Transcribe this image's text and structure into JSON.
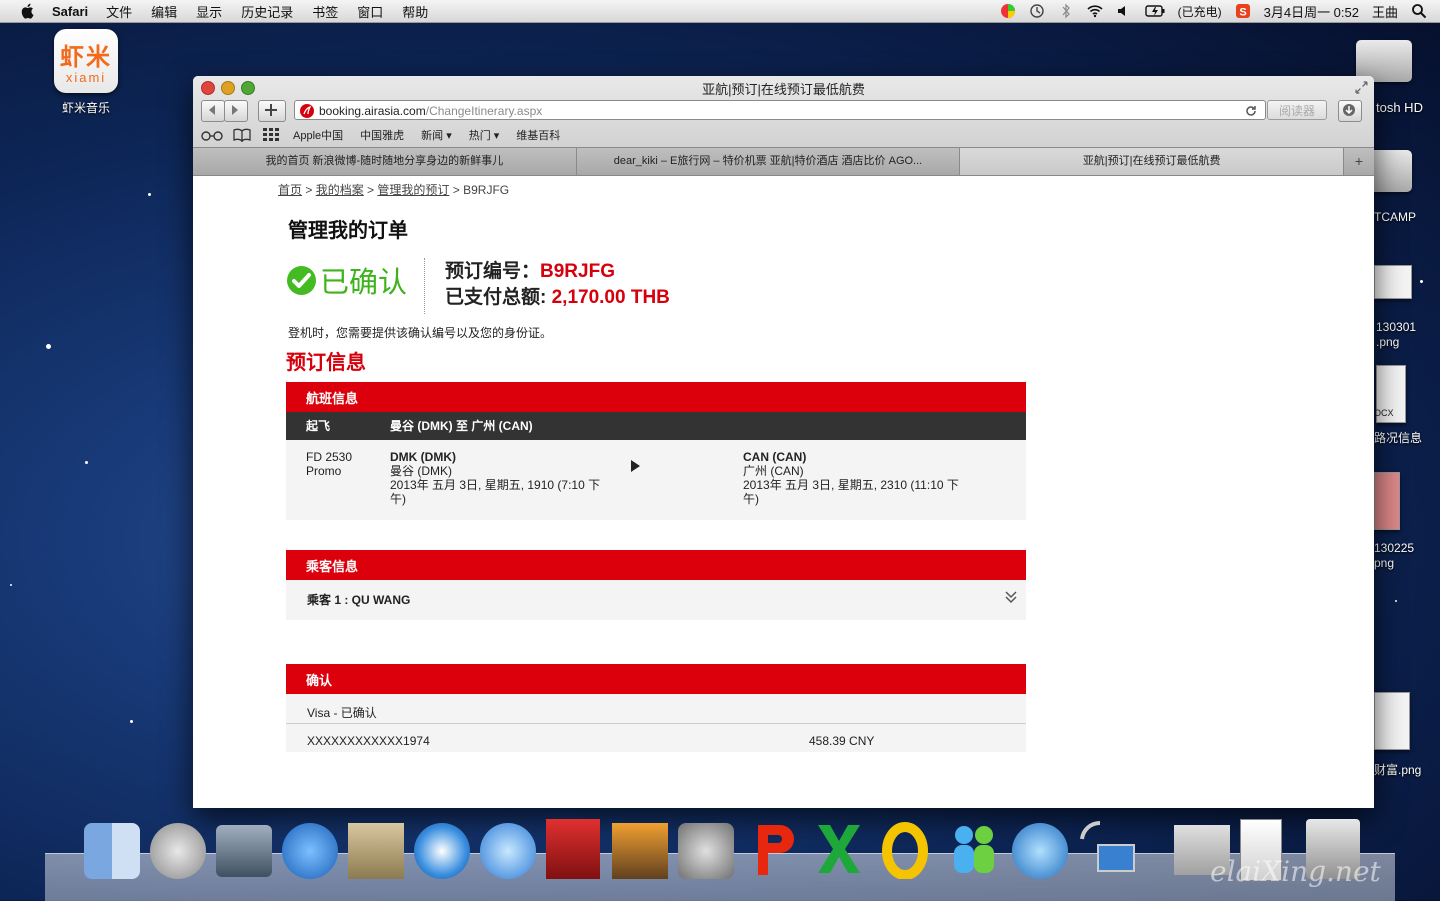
{
  "menubar": {
    "app_name": "Safari",
    "items": [
      "文件",
      "编辑",
      "显示",
      "历史记录",
      "书签",
      "窗口",
      "帮助"
    ],
    "battery": "(已充电)",
    "clock": "3月4日周一  0:52",
    "user": "王曲"
  },
  "desktop": {
    "xiami_cn": "虾米",
    "xiami_en": "xiami",
    "xiami_label": "虾米音乐",
    "labels": [
      "tosh HD",
      "TCAMP",
      "130301",
      ".png",
      "OCX",
      "路况信息",
      "130225",
      "png",
      "财富.png"
    ]
  },
  "browser": {
    "window_title": "亚航|预订|在线预订最低航费",
    "address_host": "booking.airasia.com",
    "address_path": "/ChangeItinerary.aspx",
    "reader_label": "阅读器",
    "bookmarks": [
      "Apple中国",
      "中国雅虎",
      "新闻 ▾",
      "热门 ▾",
      "维基百科"
    ],
    "tabs": [
      "我的首页 新浪微博-随时随地分享身边的新鲜事儿",
      "dear_kiki – E旅行网 – 特价机票 亚航|特价酒店 酒店比价 AGO...",
      "亚航|预订|在线预订最低航费"
    ],
    "new_tab": "+"
  },
  "page": {
    "breadcrumb": [
      "首页",
      "我的档案",
      "管理我的预订",
      "B9RJFG"
    ],
    "title": "管理我的订单",
    "status": "已确认",
    "booking_label": "预订编号：",
    "booking_number": "B9RJFG",
    "paid_label": "已支付总额: ",
    "paid_amount": "2,170.00 THB",
    "notice": "登机时，您需要提供该确认编号以及您的身份证。",
    "section_title": "预订信息",
    "flight": {
      "header": "航班信息",
      "col_depart": "起飞",
      "route": "曼谷 (DMK) 至 广州 (CAN)",
      "flight_no": "FD 2530",
      "fare_type": "Promo",
      "from_code": "DMK (DMK)",
      "from_city": "曼谷 (DMK)",
      "from_time": "2013年 五月 3日, 星期五, 1910 (7:10 下午)",
      "to_code": "CAN (CAN)",
      "to_city": "广州 (CAN)",
      "to_time": "2013年 五月 3日, 星期五, 2310 (11:10 下午)"
    },
    "passengers": {
      "header": "乘客信息",
      "passenger_1": "乘客 1 : QU WANG"
    },
    "payment": {
      "header": "确认",
      "method": "Visa - 已确认",
      "card_number": "XXXXXXXXXXXX1974",
      "amount": "458.39 CNY"
    }
  },
  "dock": {
    "watermark": "elaiXing.net"
  }
}
